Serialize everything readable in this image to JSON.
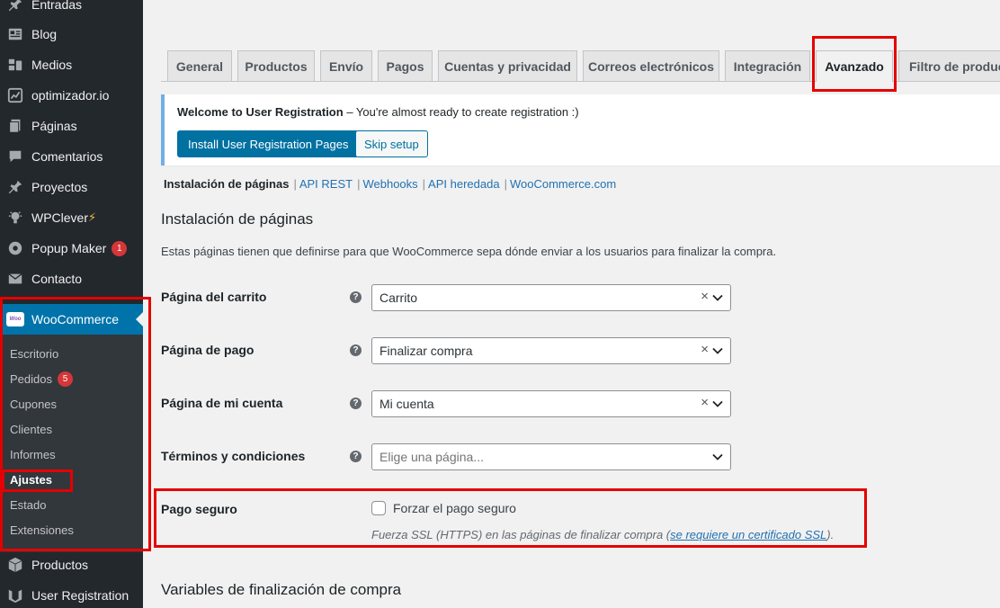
{
  "sidebar": {
    "top_items": [
      {
        "label": "Entradas",
        "icon": "pin-icon"
      },
      {
        "label": "Blog",
        "icon": "blog-icon"
      },
      {
        "label": "Medios",
        "icon": "media-icon"
      },
      {
        "label": "optimizador.io",
        "icon": "optimizer-icon"
      },
      {
        "label": "Páginas",
        "icon": "pages-icon"
      },
      {
        "label": "Comentarios",
        "icon": "comments-icon"
      },
      {
        "label": "Proyectos",
        "icon": "projects-pin-icon"
      },
      {
        "label": "WPClever",
        "icon": "bulb-icon",
        "suffix": "⚡"
      },
      {
        "label": "Popup Maker",
        "icon": "popup-icon",
        "badge": "1"
      },
      {
        "label": "Contacto",
        "icon": "mail-icon"
      }
    ],
    "woocommerce": {
      "label": "WooCommerce",
      "logo": "woo"
    },
    "submenu": [
      {
        "label": "Escritorio"
      },
      {
        "label": "Pedidos",
        "badge": "5"
      },
      {
        "label": "Cupones"
      },
      {
        "label": "Clientes"
      },
      {
        "label": "Informes"
      },
      {
        "label": "Ajustes"
      },
      {
        "label": "Estado"
      },
      {
        "label": "Extensiones"
      }
    ],
    "bottom_items": [
      {
        "label": "Productos",
        "icon": "box-icon"
      },
      {
        "label": "User Registration",
        "icon": "ur-icon"
      }
    ]
  },
  "tabs": [
    {
      "label": "General"
    },
    {
      "label": "Productos"
    },
    {
      "label": "Envío"
    },
    {
      "label": "Pagos"
    },
    {
      "label": "Cuentas y privacidad"
    },
    {
      "label": "Correos electrónicos"
    },
    {
      "label": "Integración"
    },
    {
      "label": "Avanzado",
      "active": true
    },
    {
      "label": "Filtro de produc"
    }
  ],
  "notice": {
    "title": "Welcome to User Registration",
    "text": " – You're almost ready to create registration :)",
    "primary_button": "Install User Registration Pages",
    "secondary_button": "Skip setup"
  },
  "subsub": {
    "current": "Instalación de páginas",
    "links": [
      "API REST",
      "Webhooks",
      "API heredada",
      "WooCommerce.com"
    ],
    "separator": "|"
  },
  "section": {
    "title": "Instalación de páginas",
    "description": "Estas páginas tienen que definirse para que WooCommerce sepa dónde enviar a los usuarios para finalizar la compra."
  },
  "fields": [
    {
      "label": "Página del carrito",
      "value": "Carrito",
      "clearable": true
    },
    {
      "label": "Página de pago",
      "value": "Finalizar compra",
      "clearable": true
    },
    {
      "label": "Página de mi cuenta",
      "value": "Mi cuenta",
      "clearable": true
    },
    {
      "label": "Términos y condiciones",
      "placeholder": "Elige una página...",
      "clearable": false
    }
  ],
  "secure": {
    "label": "Pago seguro",
    "checkbox_label": "Forzar el pago seguro",
    "checked": false,
    "desc_prefix": "Fuerza SSL (HTTPS) en las páginas de finalizar compra (",
    "desc_link": "se requiere un certificado SSL",
    "desc_suffix": ")."
  },
  "section2": {
    "title": "Variables de finalización de compra"
  },
  "help_glyph": "?",
  "clear_glyph": "×",
  "colors": {
    "admin_bar": "#23282d",
    "active_menu": "#0073aa",
    "highlight": "#e50000",
    "primary_button": "#0071a1"
  }
}
